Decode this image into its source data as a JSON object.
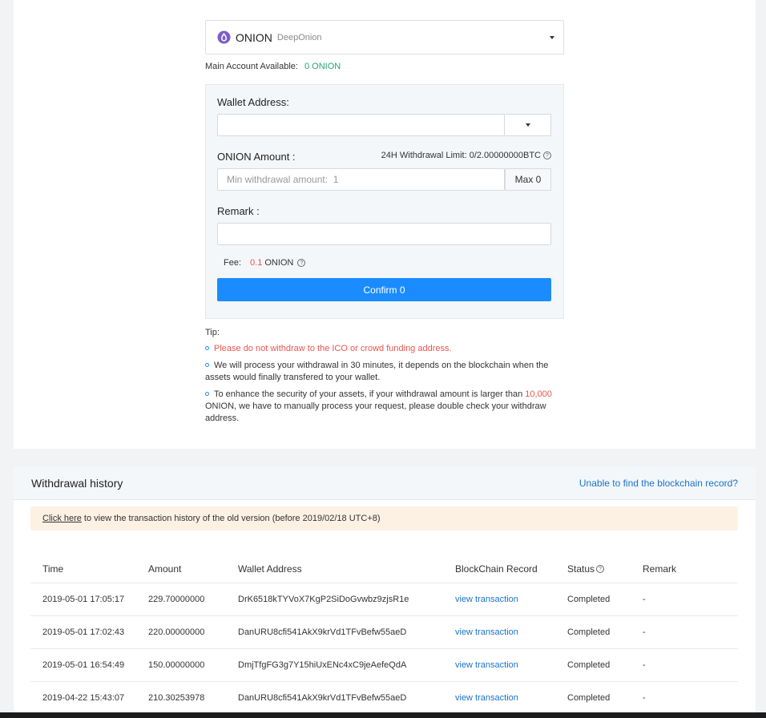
{
  "colors": {
    "accent": "#1a8cff",
    "link": "#1a73c9",
    "warning": "#e8554e",
    "success": "#27a17a"
  },
  "coin": {
    "symbol": "ONION",
    "name": "DeepOnion",
    "icon": "onion-logo-icon"
  },
  "available": {
    "label": "Main Account Available:",
    "value": "0 ONION"
  },
  "form": {
    "wallet_label": "Wallet Address:",
    "wallet_value": "",
    "amount_label": "ONION Amount :",
    "limit_text": "24H Withdrawal Limit: 0/2.00000000BTC",
    "amount_placeholder": "Min withdrawal amount:  1",
    "max_label": "Max 0",
    "remark_label": "Remark :",
    "remark_value": "",
    "fee_label": "Fee:",
    "fee_value": "0.1",
    "fee_unit": "ONION",
    "confirm_label": "Confirm 0"
  },
  "tips": {
    "title": "Tip:",
    "tip1": "Please do not withdraw to the ICO or crowd funding address.",
    "tip2": "We will process your withdrawal in 30 minutes, it depends on the blockchain when the assets would finally transfered to your wallet.",
    "tip3_a": "To enhance the security of your assets, if your withdrawal amount is larger than",
    "tip3_b": "10,000",
    "tip3_c": "ONION, we have to manually process your request, please double check your withdraw address."
  },
  "history": {
    "title": "Withdrawal history",
    "help_link": "Unable to find the blockchain record?",
    "notice_link": "Click here",
    "notice_text": "to view the transaction history of the old version (before 2019/02/18 UTC+8)",
    "columns": {
      "time": "Time",
      "amount": "Amount",
      "address": "Wallet Address",
      "chain": "BlockChain Record",
      "status": "Status",
      "remark": "Remark"
    },
    "rows": [
      {
        "time": "2019-05-01 17:05:17",
        "amount": "229.70000000",
        "address": "DrK6518kTYVoX7KgP2SiDoGvwbz9zjsR1e",
        "chain": "view transaction",
        "status": "Completed",
        "remark": "-"
      },
      {
        "time": "2019-05-01 17:02:43",
        "amount": "220.00000000",
        "address": "DanURU8cfi541AkX9krVd1TFvBefw55aeD",
        "chain": "view transaction",
        "status": "Completed",
        "remark": "-"
      },
      {
        "time": "2019-05-01 16:54:49",
        "amount": "150.00000000",
        "address": "DmjTfgFG3g7Y15hiUxENc4xC9jeAefeQdA",
        "chain": "view transaction",
        "status": "Completed",
        "remark": "-"
      },
      {
        "time": "2019-04-22 15:43:07",
        "amount": "210.30253978",
        "address": "DanURU8cfi541AkX9krVd1TFvBefw55aeD",
        "chain": "view transaction",
        "status": "Completed",
        "remark": "-"
      }
    ]
  }
}
